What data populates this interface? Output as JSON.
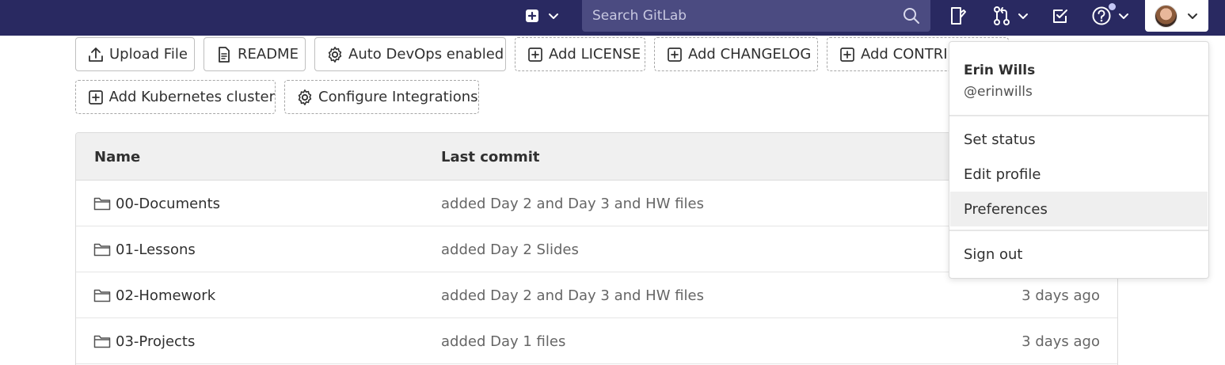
{
  "navbar": {
    "search_placeholder": "Search GitLab",
    "icons": [
      "plus-square-icon",
      "chevron-down-icon",
      "search-icon",
      "issues-icon",
      "merge-request-icon",
      "todo-checkbox-icon",
      "help-question-icon",
      "avatar"
    ],
    "brand_color": "#292961"
  },
  "actions": [
    {
      "label": "Upload File",
      "icon": "upload-icon",
      "style": "solid"
    },
    {
      "label": "README",
      "icon": "document-icon",
      "style": "solid"
    },
    {
      "label": "Auto DevOps enabled",
      "icon": "gear-icon",
      "style": "solid"
    },
    {
      "label": "Add LICENSE",
      "icon": "plus-square-icon",
      "style": "dashed"
    },
    {
      "label": "Add CHANGELOG",
      "icon": "plus-square-icon",
      "style": "dashed"
    },
    {
      "label": "Add CONTRIBUTING",
      "icon": "plus-square-icon",
      "style": "dashed"
    },
    {
      "label": "Add Kubernetes cluster",
      "icon": "plus-square-icon",
      "style": "dashed"
    },
    {
      "label": "Configure Integrations",
      "icon": "gear-icon",
      "style": "dashed"
    }
  ],
  "table": {
    "headers": {
      "name": "Name",
      "last_commit": "Last commit"
    },
    "rows": [
      {
        "name": "00-Documents",
        "commit": "added Day 2 and Day 3 and HW files",
        "time": ""
      },
      {
        "name": "01-Lessons",
        "commit": "added Day 2 Slides",
        "time": ""
      },
      {
        "name": "02-Homework",
        "commit": "added Day 2 and Day 3 and HW files",
        "time": "3 days ago"
      },
      {
        "name": "03-Projects",
        "commit": "added Day 1 files",
        "time": "3 days ago"
      }
    ]
  },
  "user_menu": {
    "name": "Erin Wills",
    "username": "@erinwills",
    "items": [
      {
        "label": "Set status"
      },
      {
        "label": "Edit profile"
      },
      {
        "label": "Preferences",
        "highlighted": true
      },
      {
        "label": "Sign out"
      }
    ]
  }
}
